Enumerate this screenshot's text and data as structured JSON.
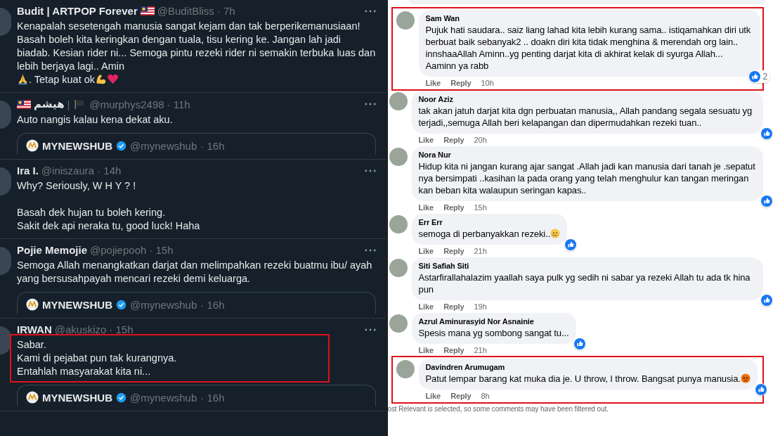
{
  "tweets": [
    {
      "name": [
        {
          "kind": "text",
          "text": "Budit | ARTPOP Forever"
        },
        {
          "kind": "flag"
        }
      ],
      "handle": "@BuditBliss",
      "time": "· 7h",
      "highlighted": false,
      "body": [
        {
          "kind": "text",
          "text": "Kenapalah sesetengah manusia sangat kejam dan tak berperikemanusiaan! Basah boleh kita keringkan dengan tuala, tisu kering ke. Jangan lah jadi biadab. Kesian rider ni... Semoga pintu rezeki rider ni semakin terbuka luas dan lebih berjaya lagi.. Amin "
        },
        {
          "kind": "pray"
        },
        {
          "kind": "text",
          "text": ". Tetap kuat ok "
        },
        {
          "kind": "muscle"
        },
        {
          "kind": "heart"
        }
      ]
    },
    {
      "name": [
        {
          "kind": "flag"
        },
        {
          "kind": "text",
          "text": "هيشم"
        },
        {
          "kind": "sep",
          "text": "|"
        },
        {
          "kind": "blackflag"
        }
      ],
      "handle": "@murphys2498",
      "time": "· 11h",
      "highlighted": false,
      "body": [
        {
          "kind": "text",
          "text": "Auto nangis kalau kena dekat aku."
        }
      ],
      "quote": {
        "name": "MYNEWSHUB",
        "handle": "@mynewshub",
        "time": "· 16h"
      }
    },
    {
      "name": [
        {
          "kind": "text",
          "text": "Ira I."
        }
      ],
      "handle": "@iniszaura",
      "time": "· 14h",
      "highlighted": false,
      "body": [
        {
          "kind": "text",
          "text": "Why? Seriously, W H Y ? !\n\nBasah dek hujan tu boleh kering.\nSakit dek api neraka tu, good luck! Haha"
        }
      ]
    },
    {
      "name": [
        {
          "kind": "text",
          "text": "Pojie Memojie"
        }
      ],
      "handle": "@pojiepooh",
      "time": "· 15h",
      "highlighted": false,
      "body": [
        {
          "kind": "text",
          "text": "Semoga Allah menangkatkan darjat dan melimpahkan rezeki buatmu ibu/ ayah yang bersusahpayah mencari rezeki demi keluarga."
        }
      ],
      "quote": {
        "name": "MYNEWSHUB",
        "handle": "@mynewshub",
        "time": "· 16h"
      }
    },
    {
      "name": [
        {
          "kind": "text",
          "text": "IRWAN"
        }
      ],
      "handle": "@akuskizo",
      "time": "· 15h",
      "highlighted": true,
      "body": [
        {
          "kind": "text",
          "text": "Sabar.\nKami di pejabat pun tak kurangnya.\nEntahlah masyarakat kita ni..."
        }
      ],
      "quote": {
        "name": "MYNEWSHUB",
        "handle": "@mynewshub",
        "time": "· 16h"
      }
    }
  ],
  "comments": [
    {
      "name": "Sam Wan",
      "highlighted": true,
      "body": [
        {
          "kind": "text",
          "text": "Pujuk hati saudara.. saiz liang lahad kita lebih kurang sama.. istiqamahkan diri utk berbuat baik sebanyak2 .. doakn diri kita tidak menghina & merendah org lain.. innshaaAllah Aminn..yg penting darjat kita di akhirat kelak di syurga Allah... Aaminn ya rabb"
        }
      ],
      "like": "Like",
      "reply": "Reply",
      "time": "10h",
      "reaction_count": "2"
    },
    {
      "name": "Noor Aziz",
      "highlighted": false,
      "body": [
        {
          "kind": "text",
          "text": "tak akan jatuh darjat kita dgn perbuatan manusia,, Allah pandang segala sesuatu yg terjadi,,semuga Allah beri kelapangan dan dipermudahkan rezeki tuan.."
        }
      ],
      "like": "Like",
      "reply": "Reply",
      "time": "20h"
    },
    {
      "name": "Nora Nur",
      "highlighted": false,
      "body": [
        {
          "kind": "text",
          "text": "Hidup kita ni jangan kurang ajar sangat .Allah jadi kan manusia dari tanah je .sepatut nya bersimpati ..kasihan la pada orang yang telah menghulur kan tangan meringan kan beban kita walaupun seringan kapas.."
        }
      ],
      "like": "Like",
      "reply": "Reply",
      "time": "15h"
    },
    {
      "name": "Err Err",
      "highlighted": false,
      "body": [
        {
          "kind": "text",
          "text": "semoga di perbanyakkan rezeki.."
        },
        {
          "kind": "sad"
        }
      ],
      "like": "Like",
      "reply": "Reply",
      "time": "21h"
    },
    {
      "name": "Siti Safiah Siti",
      "highlighted": false,
      "body": [
        {
          "kind": "text",
          "text": "Astarfirallahalazim yaallah saya pulk yg sedih ni sabar ya rezeki Allah tu ada tk hina pun"
        }
      ],
      "like": "Like",
      "reply": "Reply",
      "time": "19h"
    },
    {
      "name": "Azrul Aminurasyid Nor Asnainie",
      "highlighted": false,
      "body": [
        {
          "kind": "text",
          "text": "Spesis mana yg sombong sangat tu..."
        }
      ],
      "like": "Like",
      "reply": "Reply",
      "time": "21h"
    },
    {
      "name": "Davindren Arumugam",
      "highlighted": true,
      "body": [
        {
          "kind": "text",
          "text": "Patut lempar barang kat muka dia je. U throw, I throw. Bangsat punya manusia. "
        },
        {
          "kind": "angry"
        }
      ],
      "like": "Like",
      "reply": "Reply",
      "time": "8h"
    }
  ],
  "filter_notice": "ost Relevant is selected, so some comments may have been filtered out."
}
